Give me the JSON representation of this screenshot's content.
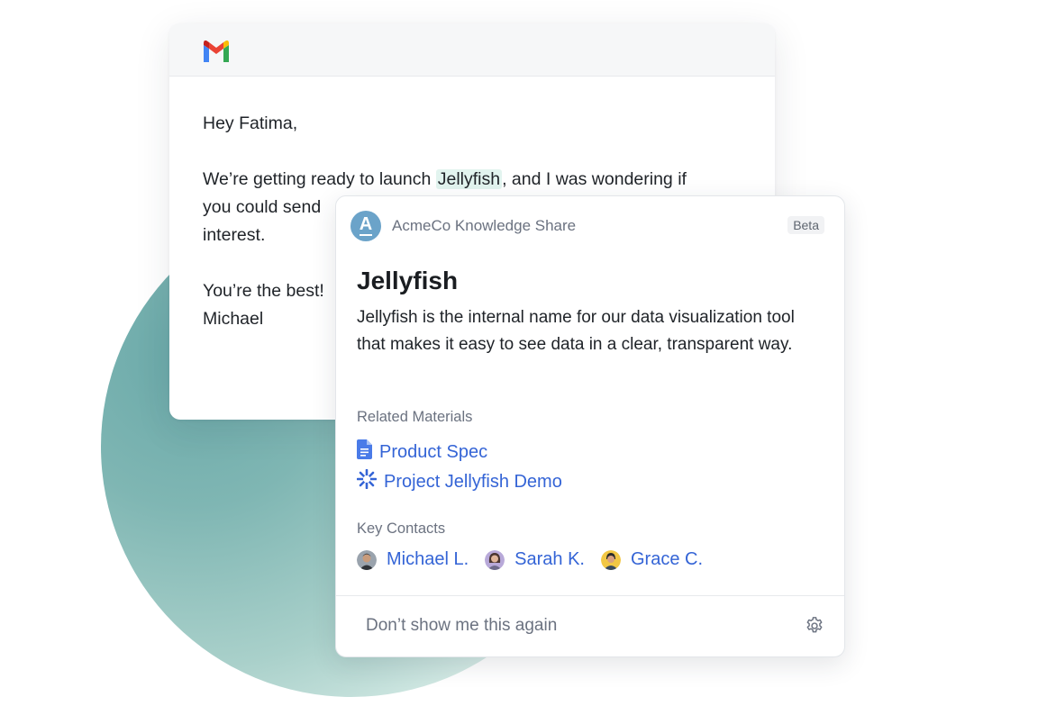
{
  "email": {
    "greeting": "Hey Fatima,",
    "line1_pre": "We’re getting ready to launch ",
    "highlight_term": "Jellyfish",
    "line1_post": ", and I was wondering if",
    "line2": "you could send",
    "line3": "interest.",
    "signoff": "You’re the best!",
    "signature": "Michael"
  },
  "card": {
    "app_name": "AcmeCo Knowledge Share",
    "logo_letter": "A",
    "badge": "Beta",
    "title": "Jellyfish",
    "description": "Jellyfish is the internal name for our data visualization tool that makes it easy to see data in a clear, transparent way.",
    "related_label": "Related Materials",
    "related": [
      {
        "label": "Product Spec",
        "icon": "document-icon"
      },
      {
        "label": "Project Jellyfish Demo",
        "icon": "sparkle-icon"
      }
    ],
    "contacts_label": "Key Contacts",
    "contacts": [
      {
        "name": "Michael L."
      },
      {
        "name": "Sarah K."
      },
      {
        "name": "Grace C."
      }
    ],
    "footer_text": "Don’t show me this again"
  },
  "colors": {
    "link": "#3464d6",
    "highlight": "#e2f4ef",
    "logo": "#6ba3c9"
  }
}
